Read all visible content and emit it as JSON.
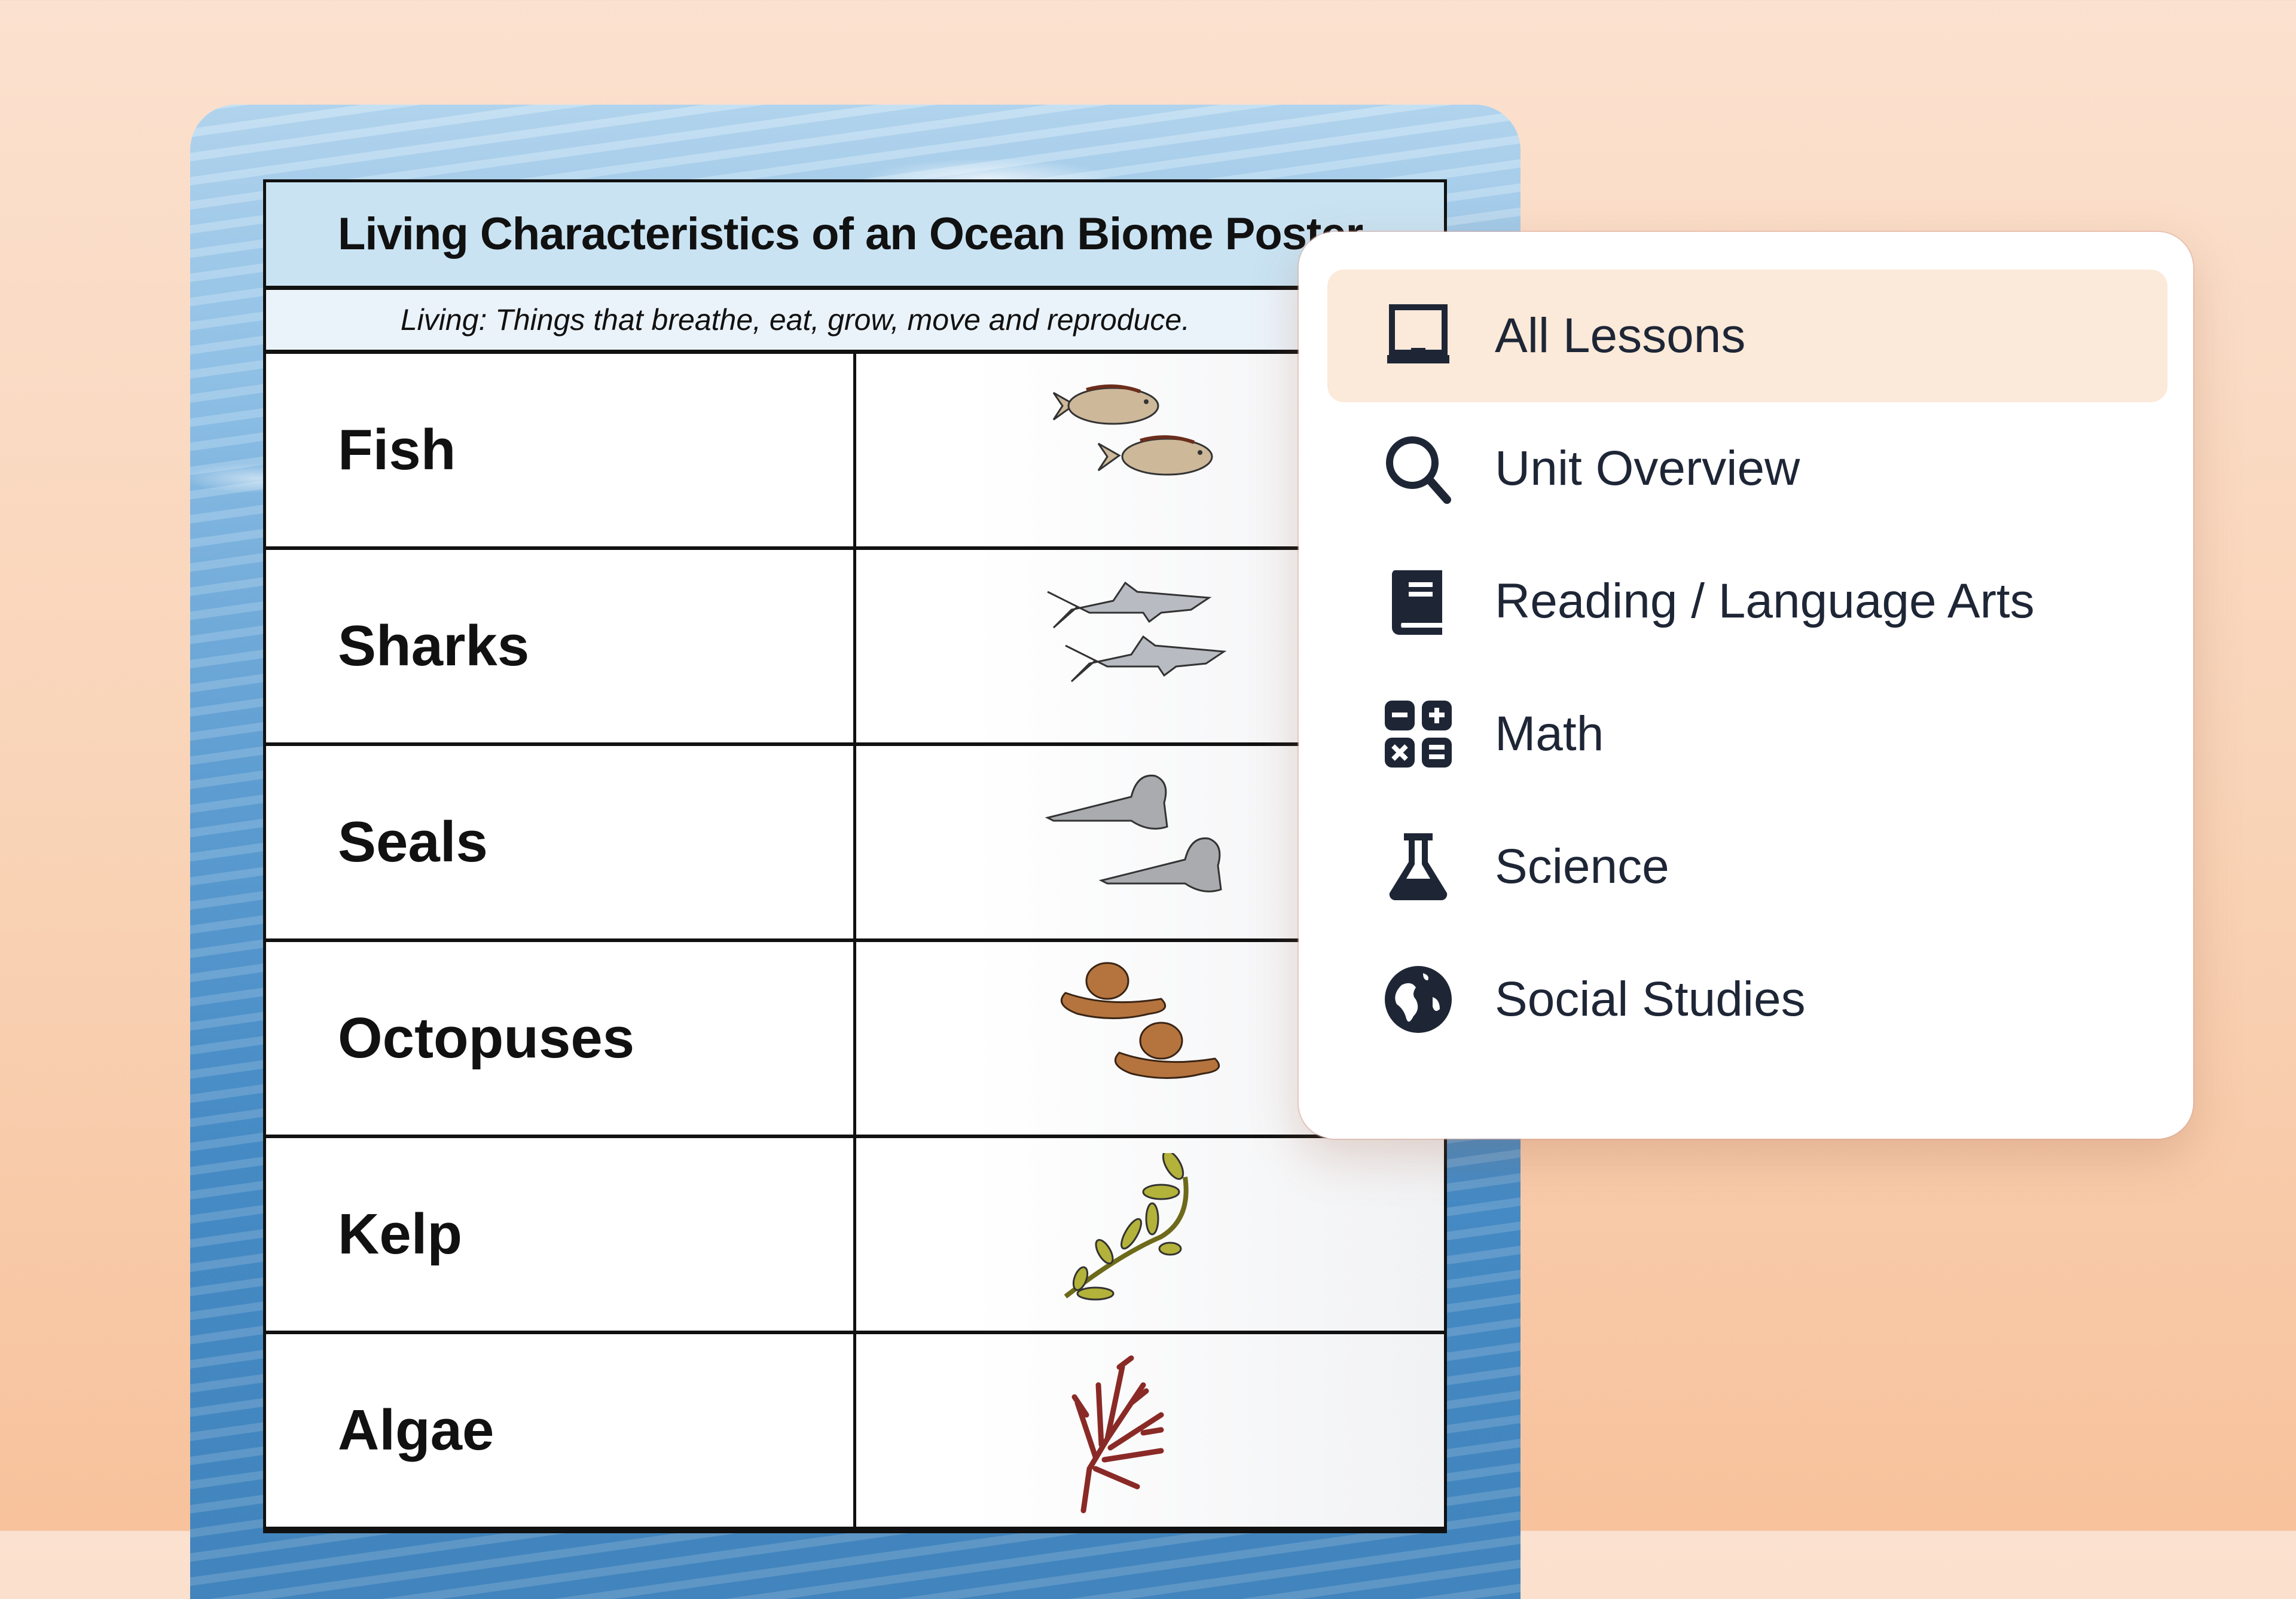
{
  "poster": {
    "title": "Living Characteristics of an Ocean Biome Poster",
    "subtitle": "Living: Things that breathe, eat, grow, move and reproduce.",
    "rows": [
      {
        "name": "Fish",
        "icon": "fish-illustration-icon"
      },
      {
        "name": "Sharks",
        "icon": "shark-illustration-icon"
      },
      {
        "name": "Seals",
        "icon": "seal-illustration-icon"
      },
      {
        "name": "Octopuses",
        "icon": "octopus-illustration-icon"
      },
      {
        "name": "Kelp",
        "icon": "kelp-illustration-icon"
      },
      {
        "name": "Algae",
        "icon": "algae-illustration-icon"
      }
    ]
  },
  "menu": {
    "items": [
      {
        "label": "All Lessons",
        "icon": "laptop-icon",
        "active": true
      },
      {
        "label": "Unit Overview",
        "icon": "search-icon",
        "active": false
      },
      {
        "label": "Reading / Language Arts",
        "icon": "book-icon",
        "active": false
      },
      {
        "label": "Math",
        "icon": "calculator-icon",
        "active": false
      },
      {
        "label": "Science",
        "icon": "flask-icon",
        "active": false
      },
      {
        "label": "Social Studies",
        "icon": "globe-icon",
        "active": false
      }
    ]
  },
  "colors": {
    "background": "#f9d3b6",
    "menu_active_bg": "#fbe9d9",
    "menu_text": "#1e2636",
    "title_row_bg": "#c9e3f3",
    "subtitle_row_bg": "#ebf3fa",
    "fish": "#cdb89a",
    "shark": "#b8bcc2",
    "seal": "#a9abaf",
    "octopus": "#b5743e",
    "kelp": "#b3b23a",
    "algae": "#8a2a26"
  }
}
